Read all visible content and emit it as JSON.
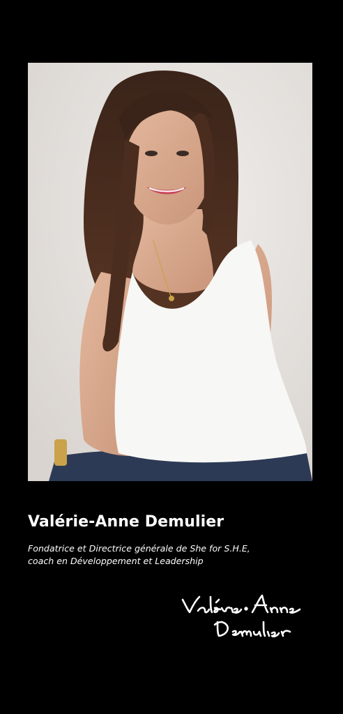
{
  "profile": {
    "name": "Valérie-Anne Demulier",
    "subtitle_line1": "Fondatrice et Directrice générale de She for S.H.E,",
    "subtitle_line2": "coach en Développement et Leadership",
    "signature_text": "Valérie-Anne Demulier"
  },
  "colors": {
    "background": "#000000",
    "text": "#ffffff",
    "photo_backdrop": "#e6e2df"
  }
}
